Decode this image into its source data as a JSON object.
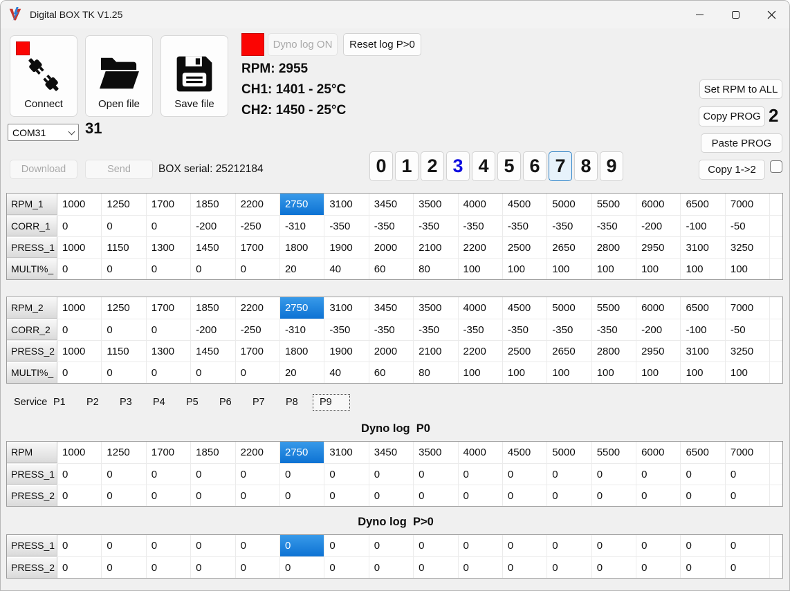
{
  "window": {
    "title": "Digital BOX TK V1.25"
  },
  "colors": {
    "accent_blue": "#0d72d3",
    "indicator_red": "#fb0503",
    "digit_blue": "#0d0bdf",
    "selection_top": "#389ae9"
  },
  "toolbar": {
    "connect_label": "Connect",
    "open_label": "Open file",
    "save_label": "Save file"
  },
  "dyno_controls": {
    "log_button": "Dyno log ON",
    "reset_button": "Reset log P>0"
  },
  "telemetry": {
    "rpm": "RPM: 2955",
    "ch1": "CH1: 1401 - 25°C",
    "ch2": "CH2: 1450 - 25°C"
  },
  "side_panel": {
    "set_rpm": "Set RPM to ALL",
    "copy_prog": "Copy PROG",
    "copy_prog_value": "2",
    "paste_prog": "Paste PROG",
    "copy_12": "Copy 1->2"
  },
  "comms": {
    "com_port": "COM31",
    "com_number": "31",
    "download": "Download",
    "send": "Send",
    "box_serial": "BOX serial: 25212184"
  },
  "prog_buttons": {
    "labels": [
      "0",
      "1",
      "2",
      "3",
      "4",
      "5",
      "6",
      "7",
      "8",
      "9"
    ],
    "blue_index": 3,
    "focused_index": 7
  },
  "prog_table_1": {
    "rows": [
      {
        "label": "RPM_1",
        "highlight": 5,
        "values": [
          1000,
          1250,
          1700,
          1850,
          2200,
          2750,
          3100,
          3450,
          3500,
          4000,
          4500,
          5000,
          5500,
          6000,
          6500,
          7000
        ]
      },
      {
        "label": "CORR_1",
        "highlight": -1,
        "values": [
          0,
          0,
          0,
          -200,
          -250,
          -310,
          -350,
          -350,
          -350,
          -350,
          -350,
          -350,
          -350,
          -200,
          -100,
          -50
        ]
      },
      {
        "label": "PRESS_1",
        "highlight": -1,
        "values": [
          1000,
          1150,
          1300,
          1450,
          1700,
          1800,
          1900,
          2000,
          2100,
          2200,
          2500,
          2650,
          2800,
          2950,
          3100,
          3250
        ]
      },
      {
        "label": "MULTI%_",
        "highlight": -1,
        "values": [
          0,
          0,
          0,
          0,
          0,
          20,
          40,
          60,
          80,
          100,
          100,
          100,
          100,
          100,
          100,
          100
        ]
      }
    ]
  },
  "prog_table_2": {
    "rows": [
      {
        "label": "RPM_2",
        "highlight": 5,
        "values": [
          1000,
          1250,
          1700,
          1850,
          2200,
          2750,
          3100,
          3450,
          3500,
          4000,
          4500,
          5000,
          5500,
          6000,
          6500,
          7000
        ]
      },
      {
        "label": "CORR_2",
        "highlight": -1,
        "values": [
          0,
          0,
          0,
          -200,
          -250,
          -310,
          -350,
          -350,
          -350,
          -350,
          -350,
          -350,
          -350,
          -200,
          -100,
          -50
        ]
      },
      {
        "label": "PRESS_2",
        "highlight": -1,
        "values": [
          1000,
          1150,
          1300,
          1450,
          1700,
          1800,
          1900,
          2000,
          2100,
          2200,
          2500,
          2650,
          2800,
          2950,
          3100,
          3250
        ]
      },
      {
        "label": "MULTI%_",
        "highlight": -1,
        "values": [
          0,
          0,
          0,
          0,
          0,
          20,
          40,
          60,
          80,
          100,
          100,
          100,
          100,
          100,
          100,
          100
        ]
      }
    ]
  },
  "tabs": {
    "items": [
      "Service",
      "P1",
      "P2",
      "P3",
      "P4",
      "P5",
      "P6",
      "P7",
      "P8",
      "P9"
    ],
    "selected": "P9"
  },
  "dyno_p0": {
    "title": "Dyno log  P0",
    "rows": [
      {
        "label": "RPM",
        "highlight": 5,
        "values": [
          1000,
          1250,
          1700,
          1850,
          2200,
          2750,
          3100,
          3450,
          3500,
          4000,
          4500,
          5000,
          5500,
          6000,
          6500,
          7000
        ]
      },
      {
        "label": "PRESS_1",
        "highlight": -1,
        "values": [
          0,
          0,
          0,
          0,
          0,
          0,
          0,
          0,
          0,
          0,
          0,
          0,
          0,
          0,
          0,
          0
        ]
      },
      {
        "label": "PRESS_2",
        "highlight": -1,
        "values": [
          0,
          0,
          0,
          0,
          0,
          0,
          0,
          0,
          0,
          0,
          0,
          0,
          0,
          0,
          0,
          0
        ]
      }
    ]
  },
  "dyno_pgt0": {
    "title": "Dyno log  P>0",
    "rows": [
      {
        "label": "PRESS_1",
        "highlight": 5,
        "values": [
          0,
          0,
          0,
          0,
          0,
          0,
          0,
          0,
          0,
          0,
          0,
          0,
          0,
          0,
          0,
          0
        ]
      },
      {
        "label": "PRESS_2",
        "highlight": -1,
        "values": [
          0,
          0,
          0,
          0,
          0,
          0,
          0,
          0,
          0,
          0,
          0,
          0,
          0,
          0,
          0,
          0
        ]
      }
    ]
  }
}
